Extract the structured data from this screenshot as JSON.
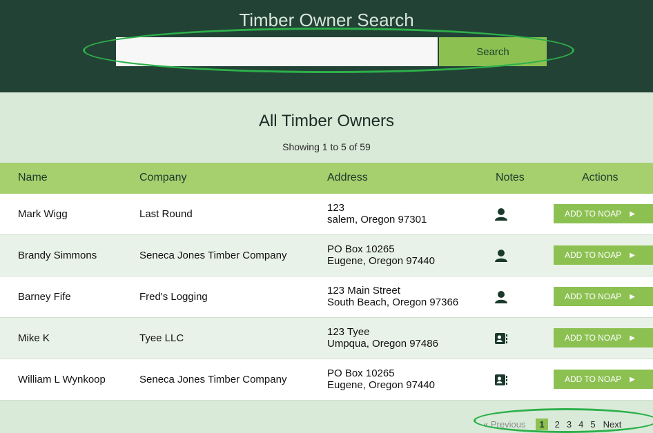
{
  "header": {
    "title": "Timber Owner Search",
    "search": {
      "value": "",
      "placeholder": "",
      "button_label": "Search"
    }
  },
  "section": {
    "title": "All Timber Owners",
    "showing": "Showing 1 to 5 of 59"
  },
  "table": {
    "columns": [
      "Name",
      "Company",
      "Address",
      "Notes",
      "Actions"
    ],
    "rows": [
      {
        "name": "Mark  Wigg",
        "company": "Last Round",
        "address_line1": "123",
        "address_line2": "salem, Oregon 97301",
        "notes_icon": "person-icon",
        "action_label": "ADD TO NOAP"
      },
      {
        "name": "Brandy  Simmons",
        "company": "Seneca Jones Timber Company",
        "address_line1": "PO Box 10265",
        "address_line2": "Eugene, Oregon 97440",
        "notes_icon": "person-icon",
        "action_label": "ADD TO NOAP"
      },
      {
        "name": "Barney  Fife",
        "company": "Fred's Logging",
        "address_line1": "123 Main Street",
        "address_line2": "South Beach, Oregon 97366",
        "notes_icon": "person-icon",
        "action_label": "ADD TO NOAP"
      },
      {
        "name": "Mike  K",
        "company": "Tyee LLC",
        "address_line1": "123 Tyee",
        "address_line2": "Umpqua, Oregon 97486",
        "notes_icon": "contact-card-icon",
        "action_label": "ADD TO NOAP"
      },
      {
        "name": "William  L Wynkoop",
        "company": "Seneca Jones Timber Company",
        "address_line1": "PO Box 10265",
        "address_line2": "Eugene, Oregon 97440",
        "notes_icon": "contact-card-icon",
        "action_label": "ADD TO NOAP"
      }
    ]
  },
  "pagination": {
    "previous": "« Previous",
    "pages": [
      "1",
      "2",
      "3",
      "4",
      "5"
    ],
    "current": "1",
    "next": "Next"
  },
  "colors": {
    "header_bg": "#234236",
    "accent_green": "#8cc152",
    "table_header_bg": "#a6cf6e",
    "page_bg": "#d9ead9",
    "annotation_oval": "#2db04a"
  }
}
